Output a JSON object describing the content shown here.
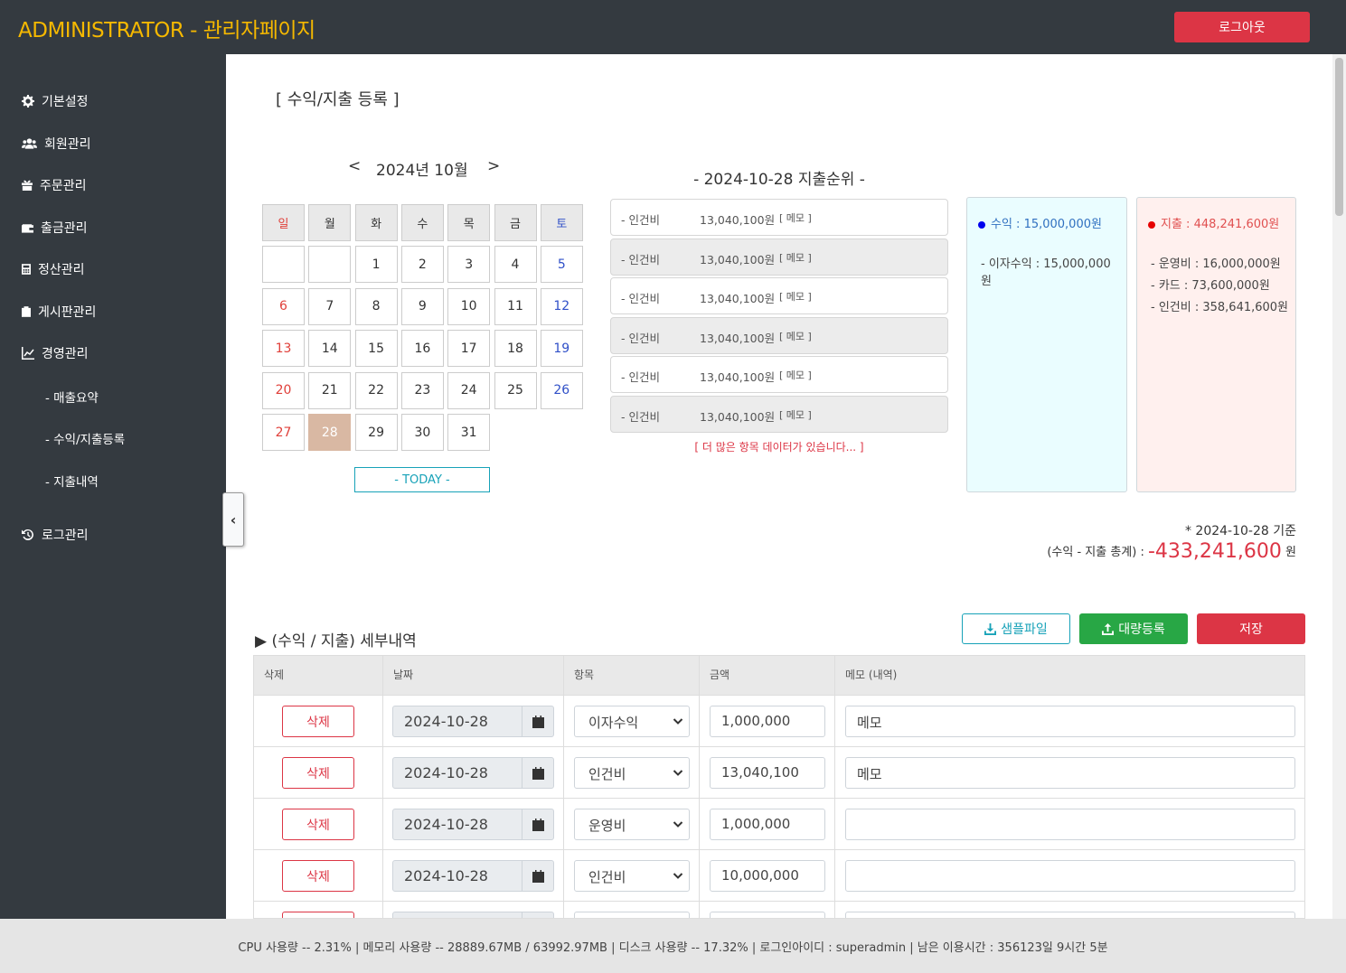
{
  "header": {
    "brand": "ADMINISTRATOR - 관리자페이지",
    "logout_label": "로그아웃"
  },
  "sidebar": {
    "items": [
      {
        "label": "기본설정",
        "icon": "gear-icon"
      },
      {
        "label": "회원관리",
        "icon": "users-icon"
      },
      {
        "label": "주문관리",
        "icon": "gift-icon"
      },
      {
        "label": "출금관리",
        "icon": "wallet-icon"
      },
      {
        "label": "정산관리",
        "icon": "calculator-icon"
      },
      {
        "label": "게시판관리",
        "icon": "clipboard-icon"
      },
      {
        "label": "경영관리",
        "icon": "chart-line-icon"
      },
      {
        "label": "로그관리",
        "icon": "history-icon"
      }
    ],
    "subitems": [
      "- 매출요약",
      "- 수익/지출등록",
      "- 지출내역"
    ],
    "collapse_glyph": "‹"
  },
  "page": {
    "title": "[ 수익/지출 등록 ]"
  },
  "calendar": {
    "prev": "<",
    "next": ">",
    "title": "2024년 10월",
    "weekdays": [
      "일",
      "월",
      "화",
      "수",
      "목",
      "금",
      "토"
    ],
    "days": [
      "",
      "",
      "1",
      "2",
      "3",
      "4",
      "5",
      "6",
      "7",
      "8",
      "9",
      "10",
      "11",
      "12",
      "13",
      "14",
      "15",
      "16",
      "17",
      "18",
      "19",
      "20",
      "21",
      "22",
      "23",
      "24",
      "25",
      "26",
      "27",
      "28",
      "29",
      "30",
      "31"
    ],
    "selected_day": "28",
    "today_label": "- TODAY -"
  },
  "ranking": {
    "title": "- 2024-10-28 지출순위 -",
    "rows": [
      {
        "name": "- 인건비",
        "amount": "13,040,100원",
        "memo": "[ 메모 ]"
      },
      {
        "name": "- 인건비",
        "amount": "13,040,100원",
        "memo": "[ 메모 ]"
      },
      {
        "name": "- 인건비",
        "amount": "13,040,100원",
        "memo": "[ 메모 ]"
      },
      {
        "name": "- 인건비",
        "amount": "13,040,100원",
        "memo": "[ 메모 ]"
      },
      {
        "name": "- 인건비",
        "amount": "13,040,100원",
        "memo": "[ 메모 ]"
      },
      {
        "name": "- 인건비",
        "amount": "13,040,100원",
        "memo": "[ 메모 ]"
      }
    ],
    "more": "[ 더 많은 항목 데이터가 있습니다... ]"
  },
  "income": {
    "head": "수익 : 15,000,000원",
    "color": "#0000ee",
    "lines": [
      "- 이자수익 : 15,000,000",
      "원"
    ]
  },
  "expense": {
    "head": "지출 : 448,241,600원",
    "color": "#e60000",
    "lines": [
      "- 운영비 : 16,000,000원",
      "- 카드 : 73,600,000원",
      "- 인건비 : 358,641,600원"
    ]
  },
  "summary": {
    "date": "* 2024-10-28 기준",
    "label": "(수익 - 지출 총계) :",
    "total": "-433,241,600",
    "unit": "원"
  },
  "detail": {
    "title": "▶ (수익 / 지출) 세부내역",
    "sample_label": "샘플파일",
    "bulk_label": "대량등록",
    "save_label": "저장",
    "columns": [
      "삭제",
      "날짜",
      "항목",
      "금액",
      "메모 (내역)"
    ],
    "delete_label": "삭제",
    "rows": [
      {
        "date": "2024-10-28",
        "category": "이자수익",
        "amount": "1,000,000",
        "memo": "메모"
      },
      {
        "date": "2024-10-28",
        "category": "인건비",
        "amount": "13,040,100",
        "memo": "메모"
      },
      {
        "date": "2024-10-28",
        "category": "운영비",
        "amount": "1,000,000",
        "memo": ""
      },
      {
        "date": "2024-10-28",
        "category": "인건비",
        "amount": "10,000,000",
        "memo": ""
      }
    ]
  },
  "footer": {
    "status": "CPU 사용량 -- 2.31% | 메모리 사용량 -- 28889.67MB / 63992.97MB | 디스크 사용량 -- 17.32%  |   로그인아이디 : superadmin  |   남은 이용시간 : 356123일 9시간 5분"
  }
}
